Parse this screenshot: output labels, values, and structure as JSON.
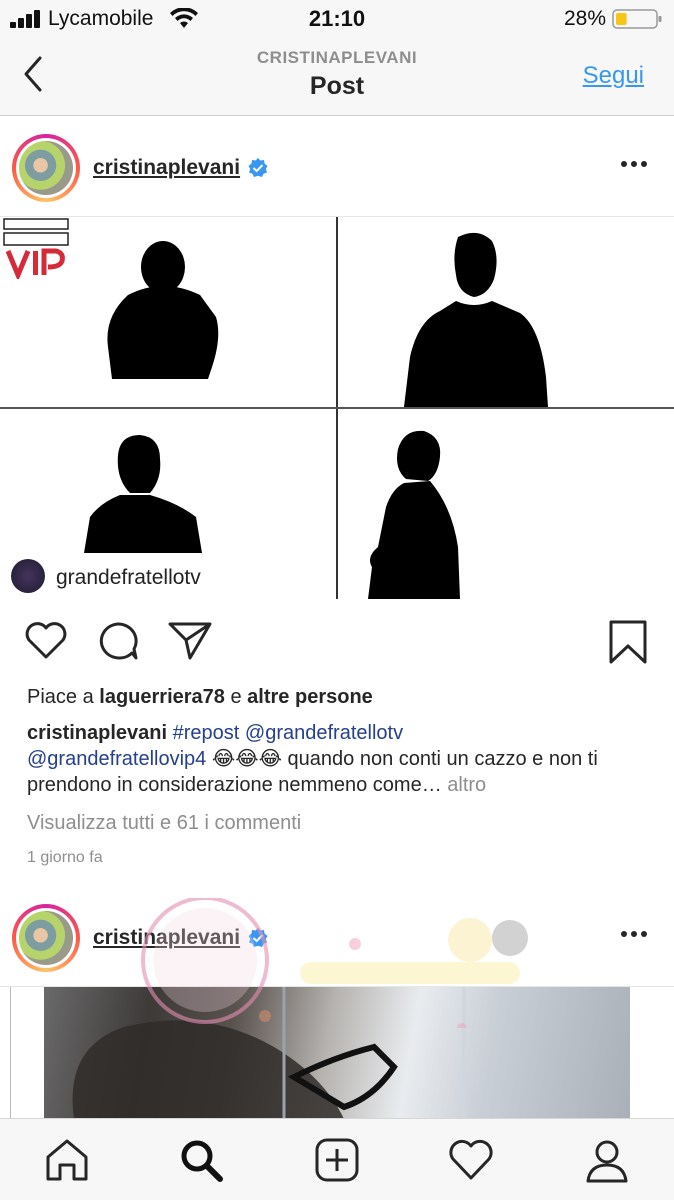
{
  "status_bar": {
    "carrier": "Lycamobile",
    "time": "21:10",
    "battery_percent": "28%",
    "battery_level": 0.28,
    "icons": [
      "signal-icon",
      "wifi-icon",
      "battery-icon"
    ]
  },
  "nav": {
    "subtitle": "CRISTINAPLEVANI",
    "title": "Post",
    "follow_label": "Segui",
    "back_icon": "chevron-left-icon"
  },
  "post": {
    "username": "cristinaplevani",
    "verified": true,
    "image_watermark_user": "grandefratellotv",
    "likes": {
      "prefix": "Piace a",
      "user": "laguerriera78",
      "conj": "e",
      "suffix": "altre persone"
    },
    "caption": {
      "username": "cristinaplevani",
      "hashtag": "#repost",
      "mention1": "@grandefratellotv",
      "mention2": "@grandefratellovip4",
      "emojis": "😂😂😂",
      "text": "quando non conti un cazzo e non ti prendono in considerazione nemmeno come…",
      "more": "altro"
    },
    "view_comments": "Visualizza tutti e 61 i commenti",
    "time_ago": "1 giorno fa"
  },
  "post2": {
    "username": "cristinaplevani",
    "verified": true
  },
  "colors": {
    "accent": "#3897f0",
    "text": "#262626",
    "muted": "#8e8e8e",
    "link": "#25408f",
    "bar_bg": "#f7f7f7"
  },
  "tabbar": [
    "home-icon",
    "search-icon",
    "add-icon",
    "heart-icon",
    "profile-icon"
  ]
}
